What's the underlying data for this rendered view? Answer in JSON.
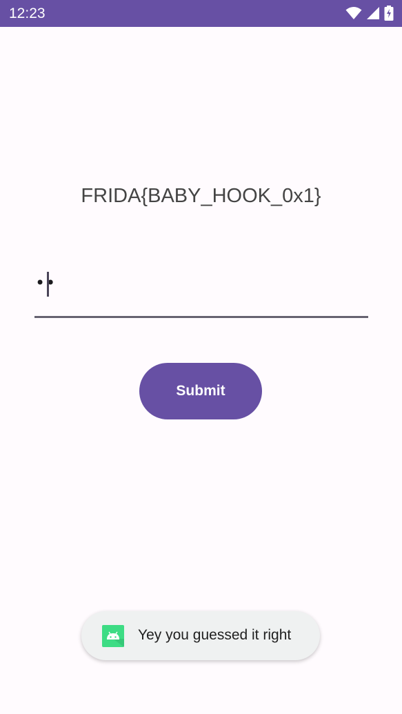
{
  "status_bar": {
    "time": "12:23",
    "background_color": "#6750a4",
    "icons": [
      "wifi-icon",
      "cellular-signal-icon",
      "battery-charging-icon"
    ]
  },
  "main": {
    "flag_text": "FRIDA{BABY_HOOK_0x1}",
    "password_field": {
      "masked_value": "••"
    },
    "submit_button": {
      "label": "Submit",
      "color": "#6750a4"
    }
  },
  "toast": {
    "icon": "android-app-icon",
    "message": "Yey you guessed it right"
  }
}
